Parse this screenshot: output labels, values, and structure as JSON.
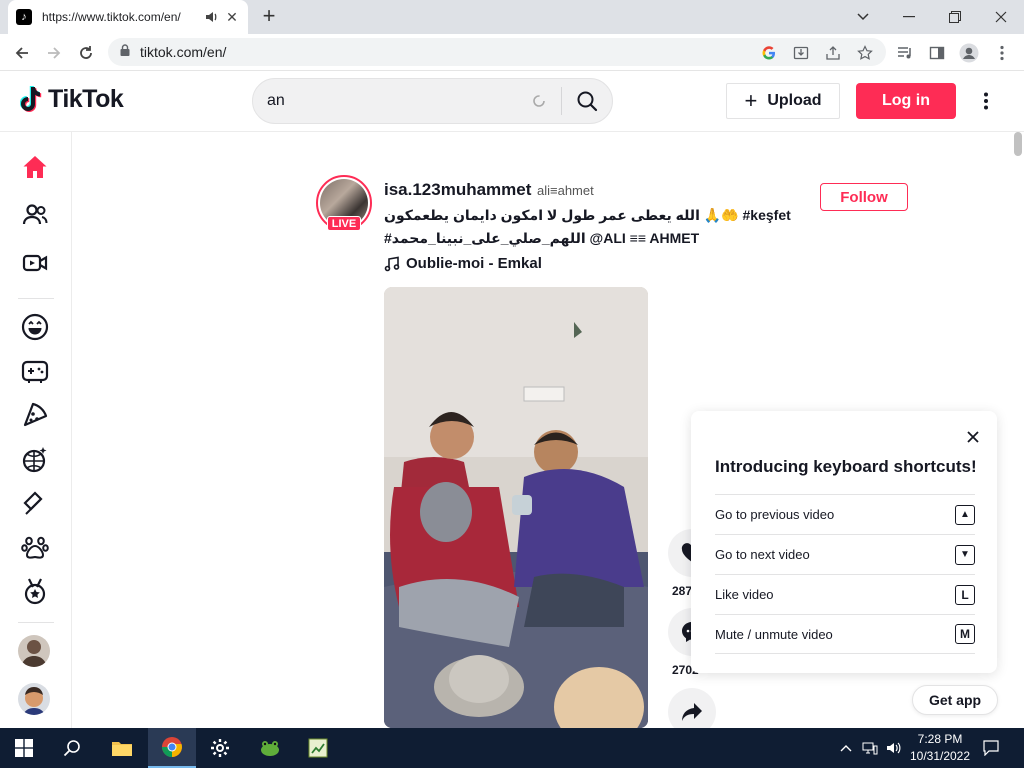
{
  "browser": {
    "tab_title": "https://www.tiktok.com/en/",
    "url": "tiktok.com/en/"
  },
  "tiktok": {
    "logo_text": "TikTok",
    "search_value": "an",
    "upload_label": "Upload",
    "login_label": "Log in"
  },
  "post": {
    "username": "isa.123muhammet",
    "nickname": "ali≡ahmet",
    "live_label": "LIVE",
    "caption_line1": "الله يعطى عمر طول لا امكون دايمان يطعمكون 🙏🤲 #keşfet",
    "caption_line2": "#اللهم_صلي_على_نبينا_محمد @ALI ≡≡ AHMET",
    "music": "Oublie-moi - Emkal",
    "follow_label": "Follow",
    "like_count": "287",
    "comment_count": "2702"
  },
  "shortcuts": {
    "title": "Introducing keyboard shortcuts!",
    "items": [
      {
        "label": "Go to previous video",
        "key": "▲"
      },
      {
        "label": "Go to next video",
        "key": "▼"
      },
      {
        "label": "Like video",
        "key": "L"
      },
      {
        "label": "Mute / unmute video",
        "key": "M"
      }
    ]
  },
  "get_app_label": "Get app",
  "taskbar": {
    "time": "7:28 PM",
    "date": "10/31/2022"
  },
  "colors": {
    "brand": "#fe2c55",
    "text": "#161823"
  }
}
